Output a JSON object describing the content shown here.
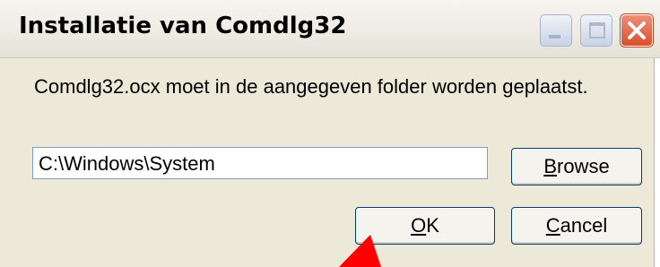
{
  "window": {
    "title": "Installatie van Comdlg32",
    "controls": {
      "minimize_icon": "minimize-icon",
      "maximize_icon": "maximize-icon",
      "close_icon": "close-icon",
      "close_glyph": "✕"
    }
  },
  "message": "Comdlg32.ocx moet in de aangegeven folder worden geplaatst.",
  "path_field": {
    "value": "C:\\Windows\\System"
  },
  "buttons": {
    "browse": {
      "mnemonic": "B",
      "rest": "rowse"
    },
    "ok": {
      "mnemonic": "O",
      "rest": "K"
    },
    "cancel": {
      "mnemonic": "C",
      "rest": "ancel"
    }
  },
  "colors": {
    "close_button": "#d94f2a",
    "dialog_bg": "#ece9d8",
    "cursor": "#ff0000",
    "button_border": "#003c74"
  }
}
